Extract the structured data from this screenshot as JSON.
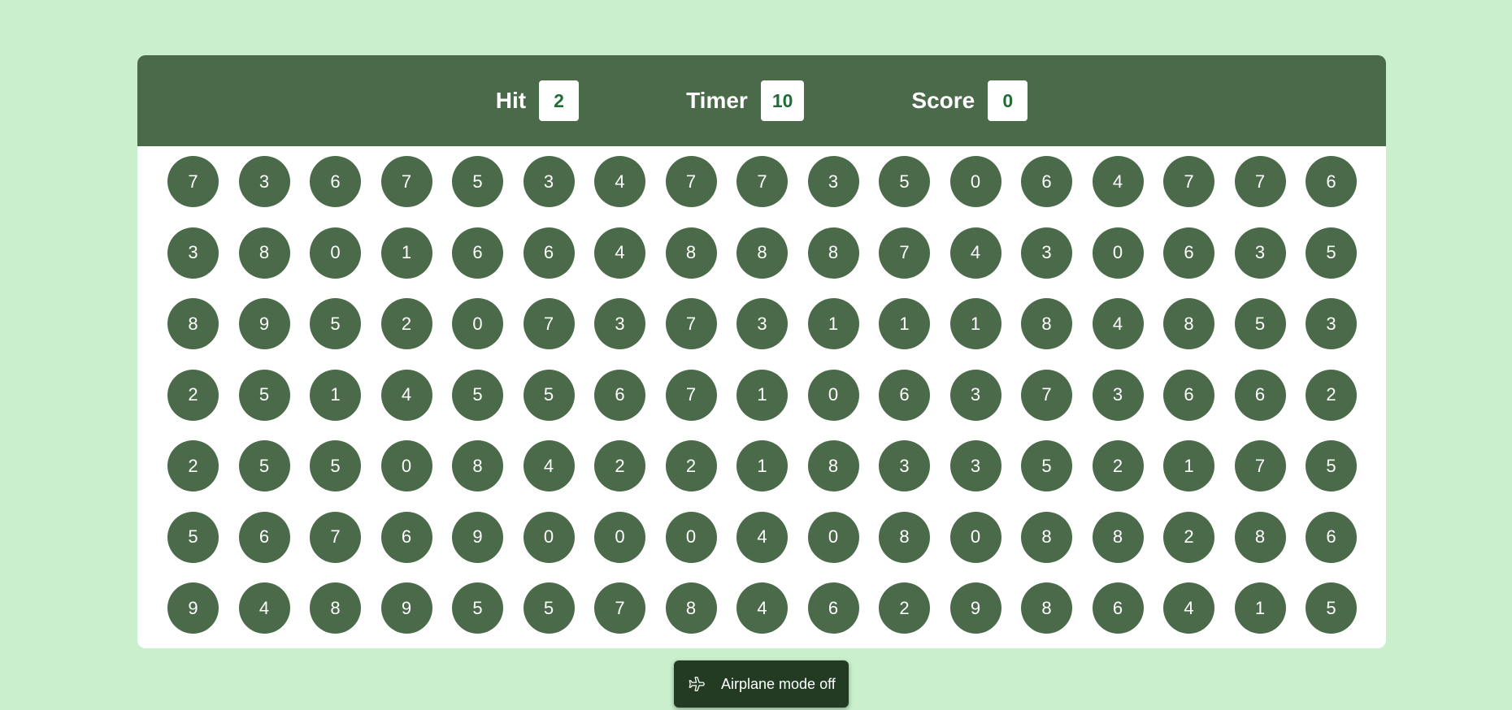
{
  "header": {
    "hit_label": "Hit",
    "hit_value": "2",
    "timer_label": "Timer",
    "timer_value": "10",
    "score_label": "Score",
    "score_value": "0"
  },
  "bubbles": [
    [
      "7",
      "3",
      "6",
      "7",
      "5",
      "3",
      "4",
      "7",
      "7",
      "3",
      "5",
      "0",
      "6",
      "4",
      "7",
      "7",
      "6"
    ],
    [
      "3",
      "8",
      "0",
      "1",
      "6",
      "6",
      "4",
      "8",
      "8",
      "8",
      "7",
      "4",
      "3",
      "0",
      "6",
      "3",
      "5"
    ],
    [
      "8",
      "9",
      "5",
      "2",
      "0",
      "7",
      "3",
      "7",
      "3",
      "1",
      "1",
      "1",
      "8",
      "4",
      "8",
      "5",
      "3"
    ],
    [
      "2",
      "5",
      "1",
      "4",
      "5",
      "5",
      "6",
      "7",
      "1",
      "0",
      "6",
      "3",
      "7",
      "3",
      "6",
      "6",
      "2"
    ],
    [
      "2",
      "5",
      "5",
      "0",
      "8",
      "4",
      "2",
      "2",
      "1",
      "8",
      "3",
      "3",
      "5",
      "2",
      "1",
      "7",
      "5"
    ],
    [
      "5",
      "6",
      "7",
      "6",
      "9",
      "0",
      "0",
      "0",
      "4",
      "0",
      "8",
      "0",
      "8",
      "8",
      "2",
      "8",
      "6"
    ],
    [
      "9",
      "4",
      "8",
      "9",
      "5",
      "5",
      "7",
      "8",
      "4",
      "6",
      "2",
      "9",
      "8",
      "6",
      "4",
      "1",
      "5"
    ]
  ],
  "toast": {
    "icon": "airplane-icon",
    "text": "Airplane mode off"
  },
  "colors": {
    "background": "#c9efcc",
    "panel_header": "#4a6a4a",
    "bubble": "#4a6a4a",
    "stat_value_text": "#1e6e36",
    "toast_bg": "#223b22"
  }
}
